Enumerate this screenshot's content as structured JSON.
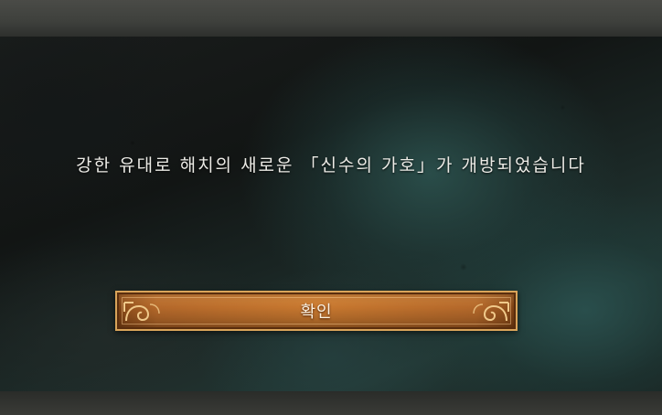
{
  "popup": {
    "message": "강한 유대로 해치의 새로운 「신수의 가호」가 개방되었습니다",
    "confirm_label": "확인"
  },
  "colors": {
    "button_fill": "#c8782f",
    "button_border": "#d9a45a",
    "panel_teal": "#2c5654"
  }
}
